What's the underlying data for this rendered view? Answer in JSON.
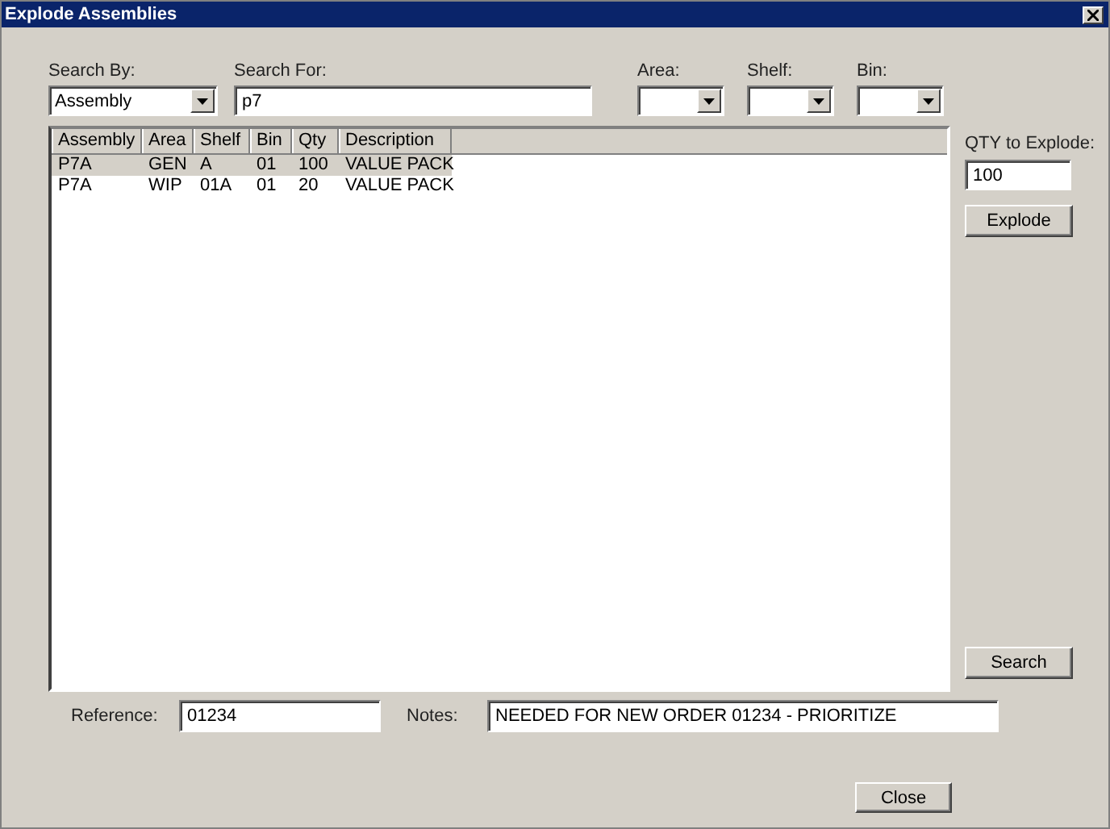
{
  "window": {
    "title": "Explode Assemblies"
  },
  "filters": [
    {
      "label": "Search By:",
      "kind": "select",
      "value": "Assembly"
    },
    {
      "label": "Search For:",
      "kind": "text",
      "value": "p7"
    },
    {
      "label": "Area:",
      "kind": "select"
    },
    {
      "label": "Shelf:",
      "kind": "select"
    },
    {
      "label": "Bin:",
      "kind": "select"
    }
  ],
  "table": {
    "columns": [
      "Assembly",
      "Area",
      "Shelf",
      "Bin",
      "Qty",
      "Description"
    ],
    "rows": [
      {
        "selected": true,
        "cells": [
          "P7A",
          "GEN",
          "A",
          "01",
          "100",
          "VALUE PACK"
        ]
      },
      {
        "selected": false,
        "cells": [
          "P7A",
          "WIP",
          "01A",
          "01",
          "20",
          "VALUE PACK"
        ]
      }
    ]
  },
  "qty": {
    "label": "QTY to Explode:",
    "value": "100"
  },
  "buttons": {
    "explode": "Explode",
    "search": "Search",
    "close": "Close"
  },
  "reference": {
    "label": "Reference:",
    "value": "01234"
  },
  "notes": {
    "label": "Notes:",
    "value": "NEEDED FOR NEW ORDER 01234 - PRIORITIZE"
  }
}
